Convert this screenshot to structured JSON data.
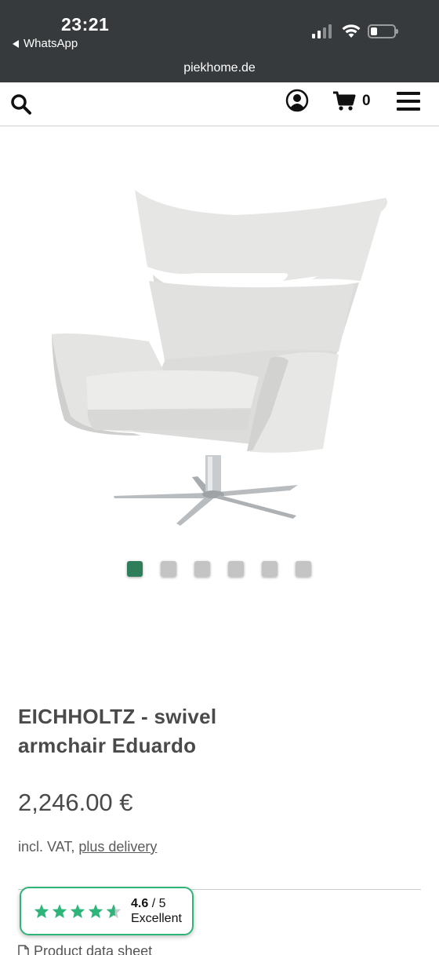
{
  "status_bar": {
    "time": "23:21",
    "back_app": "WhatsApp",
    "url": "piekhome.de"
  },
  "header": {
    "cart_count": "0"
  },
  "carousel": {
    "total": 6,
    "active_index": 0,
    "active_color": "#2e7d5b"
  },
  "product": {
    "title": "EICHHOLTZ - swivel armchair Eduardo",
    "price": "2,246.00 €",
    "vat_prefix": "incl. VAT,",
    "vat_link": "plus delivery",
    "datasheet_label": "Product data sheet"
  },
  "rating": {
    "score": "4.6",
    "max": "/ 5",
    "label": "Excellent",
    "star_color": "#2fb47a"
  },
  "icons": [
    "search-icon",
    "account-icon",
    "cart-icon",
    "menu-icon",
    "document-icon",
    "star-icon"
  ]
}
